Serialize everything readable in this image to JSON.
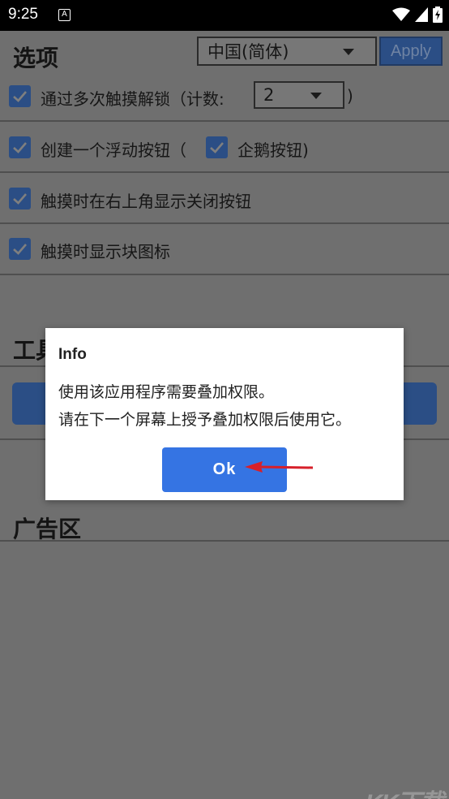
{
  "status_bar": {
    "time": "9:25",
    "notification_icon": "A"
  },
  "options": {
    "title": "选项",
    "language_value": "中国(简体)",
    "apply_label": "Apply"
  },
  "settings": [
    {
      "label_before": "通过多次触摸解锁（计数:",
      "count_value": "2",
      "label_after": ")",
      "checked": true
    },
    {
      "label_before": "创建一个浮动按钮（",
      "sub_label": "企鹅按钮)",
      "checked": true,
      "sub_checked": true
    },
    {
      "label": "触摸时在右上角显示关闭按钮",
      "checked": true
    },
    {
      "label": "触摸时显示块图标",
      "checked": true
    }
  ],
  "tools": {
    "title": "工具"
  },
  "ads": {
    "title": "广告区"
  },
  "dialog": {
    "title": "Info",
    "line1": "使用该应用程序需要叠加权限。",
    "line2": "请在下一个屏幕上授予叠加权限后使用它。",
    "ok_label": "Ok"
  },
  "watermark": "KK下载",
  "colors": {
    "accent_dimmed": "#2b4e85",
    "dialog_button": "#3574e3",
    "annotation_arrow": "#d7202a"
  }
}
